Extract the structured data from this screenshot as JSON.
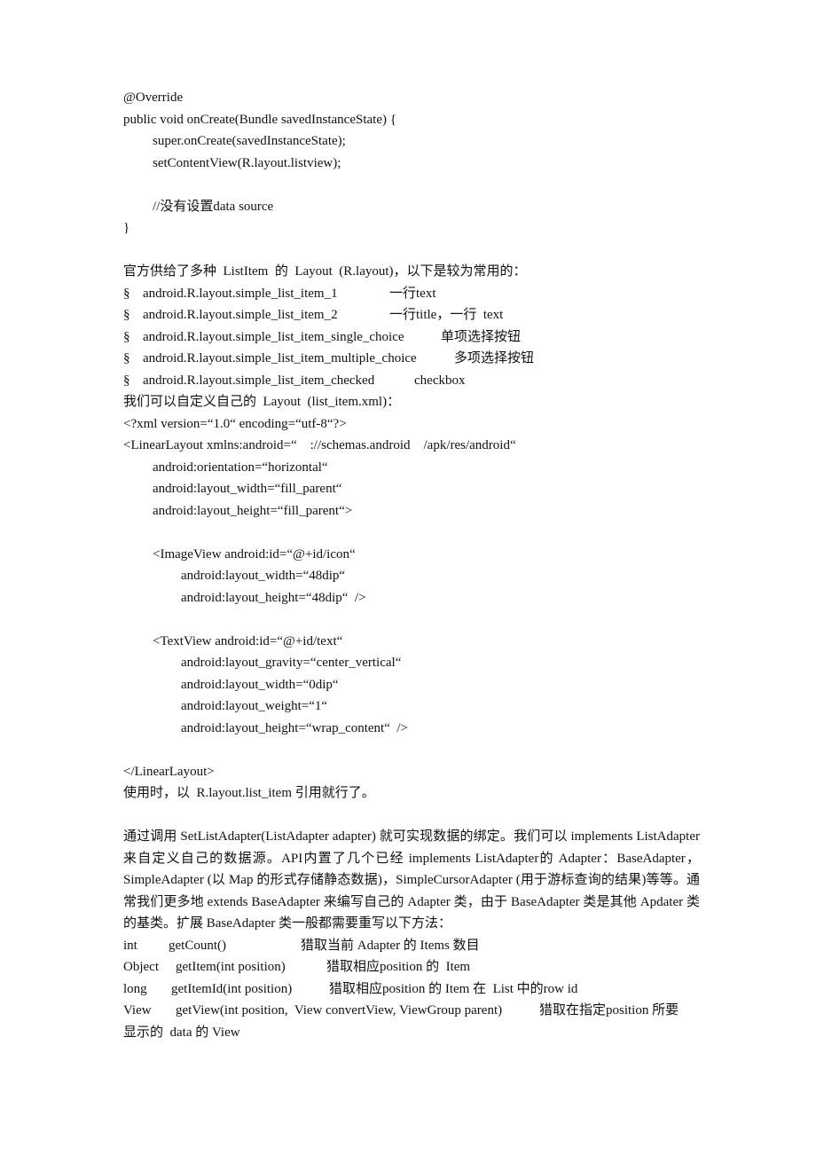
{
  "code_block_1": {
    "lines": [
      "@Override",
      "public void onCreate(Bundle savedInstanceState) {",
      "super.onCreate(savedInstanceState);",
      "setContentView(R.layout.listview);",
      "",
      "//没有设置data source",
      "}"
    ]
  },
  "layouts_intro": "官方供给了多种  ListItem  的  Layout  (R.layout)，以下是较为常用的：",
  "layout_list": {
    "bullet_symbol": "§",
    "items": [
      {
        "code": "android.R.layout.simple_list_item_1",
        "desc": "一行text"
      },
      {
        "code": "android.R.layout.simple_list_item_2",
        "desc": "一行title，一行  text"
      },
      {
        "code": "android.R.layout.simple_list_item_single_choice",
        "desc": "单项选择按钮"
      },
      {
        "code": "android.R.layout.simple_list_item_multiple_choice",
        "desc": "多项选择按钮"
      },
      {
        "code": "android.R.layout.simple_list_item_checked",
        "desc": "checkbox"
      }
    ]
  },
  "custom_layout_intro": "我们可以自定义自己的  Layout  (list_item.xml)：",
  "xml_block": {
    "lines": [
      "<?xml version=“1.0“ encoding=“utf-8“?>",
      "<LinearLayout xmlns:android=“    ://schemas.android    /apk/res/android“",
      "android:orientation=“horizontal“",
      "android:layout_width=“fill_parent“",
      "android:layout_height=“fill_parent“>",
      "",
      "<ImageView android:id=“@+id/icon“",
      "android:layout_width=“48dip“",
      "android:layout_height=“48dip“  />",
      "",
      "<TextView android:id=“@+id/text“",
      "android:layout_gravity=“center_vertical“",
      "android:layout_width=“0dip“",
      "android:layout_weight=“1“",
      "android:layout_height=“wrap_content“  />",
      "",
      "</LinearLayout>"
    ]
  },
  "usage_note": "使用时，以  R.layout.list_item 引用就行了。",
  "adapter_paragraph": "通过调用    SetListAdapter(ListAdapter   adapter) 就可实现数据的绑定。我们可以      implements ListAdapter来自定义自己的数据源。API内置了几个已经 implements ListAdapter的 Adapter：BaseAdapter，SimpleAdapter (以 Map 的形式存储静态数据)，SimpleCursorAdapter (用于游标查询的结果)等等。通常我们更多地    extends BaseAdapter 来编写自己的    Adapter 类，由于 BaseAdapter  类是其他  Apdater 类的基类。扩展  BaseAdapter 类一般都需要重写以下方法：",
  "methods": [
    {
      "type": "int",
      "signature": "getCount()",
      "desc": "猎取当前 Adapter 的 Items 数目"
    },
    {
      "type": "Object",
      "signature": "getItem(int position)",
      "desc": "猎取相应position 的  Item"
    },
    {
      "type": "long",
      "signature": "getItemId(int position)",
      "desc": "猎取相应position 的 Item 在  List 中的row id"
    },
    {
      "type": "View",
      "signature": "getView(int position,  View convertView, ViewGroup parent)",
      "desc": "猎取在指定position 所要"
    }
  ],
  "methods_tail": "显示的  data 的 View"
}
